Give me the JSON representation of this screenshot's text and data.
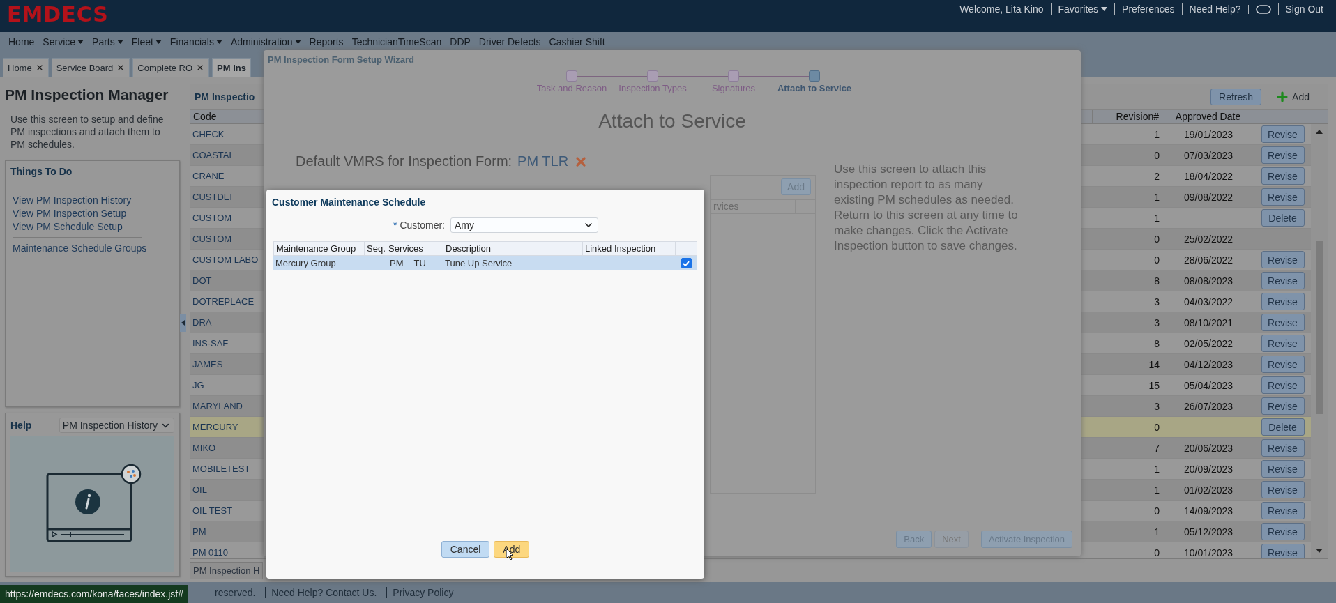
{
  "header": {
    "logo": "EMDECS",
    "links": [
      {
        "kind": "text",
        "label": "Welcome, Lita Kino"
      },
      {
        "kind": "menu",
        "label": "Favorites"
      },
      {
        "kind": "link",
        "label": "Preferences"
      },
      {
        "kind": "link",
        "label": "Need Help?"
      },
      {
        "kind": "icon"
      },
      {
        "kind": "link",
        "label": "Sign Out"
      }
    ]
  },
  "nav": [
    {
      "label": "Home",
      "menu": false
    },
    {
      "label": "Service",
      "menu": true
    },
    {
      "label": "Parts",
      "menu": true
    },
    {
      "label": "Fleet",
      "menu": true
    },
    {
      "label": "Financials",
      "menu": true
    },
    {
      "label": "Administration",
      "menu": true
    },
    {
      "label": "Reports",
      "menu": false
    },
    {
      "label": "TechnicianTimeScan",
      "menu": false
    },
    {
      "label": "DDP",
      "menu": false
    },
    {
      "label": "Driver Defects",
      "menu": false
    },
    {
      "label": "Cashier Shift",
      "menu": false
    }
  ],
  "tabs": [
    {
      "label": "Home",
      "selected": false,
      "closable": true
    },
    {
      "label": "Service Board",
      "selected": false,
      "closable": true
    },
    {
      "label": "Complete RO",
      "selected": false,
      "closable": true
    },
    {
      "label": "PM Ins",
      "selected": true,
      "closable": false
    }
  ],
  "sidebar": {
    "title": "PM Inspection Manager",
    "description": "Use this screen to setup and define PM inspections and attach them to PM schedules.",
    "things_to_do": {
      "title": "Things To Do",
      "links": [
        "View PM Inspection History",
        "View PM Inspection Setup",
        "View PM Schedule Setup"
      ],
      "extra_links": [
        "Maintenance Schedule Groups"
      ]
    },
    "help": {
      "title": "Help",
      "topic": "PM Inspection History"
    }
  },
  "table": {
    "title": "PM Inspectio",
    "buttons": [
      {
        "kind": "plain",
        "label": "Refresh"
      },
      {
        "kind": "add",
        "label": "Add"
      }
    ],
    "columns": [
      "Code",
      "Revision#",
      "Approved Date"
    ],
    "rows": [
      {
        "code": "CHECK",
        "revision": "1",
        "approved_date": "19/01/2023",
        "action": "Revise",
        "selected": false
      },
      {
        "code": "COASTAL",
        "revision": "0",
        "approved_date": "07/03/2023",
        "action": "Revise",
        "selected": false
      },
      {
        "code": "CRANE",
        "revision": "2",
        "approved_date": "18/04/2022",
        "action": "Revise",
        "selected": false
      },
      {
        "code": "CUSTDEF",
        "revision": "1",
        "approved_date": "09/08/2022",
        "action": "Revise",
        "selected": false
      },
      {
        "code": "CUSTOM",
        "revision": "1",
        "action": "Delete",
        "selected": false
      },
      {
        "code": "CUSTOM",
        "revision": "0",
        "approved_date": "25/02/2022",
        "selected": false
      },
      {
        "code": "CUSTOM LABO",
        "revision": "0",
        "approved_date": "28/06/2022",
        "action": "Revise",
        "selected": false
      },
      {
        "code": "DOT",
        "revision": "8",
        "approved_date": "08/08/2023",
        "action": "Revise",
        "selected": false
      },
      {
        "code": "DOTREPLACE",
        "revision": "3",
        "approved_date": "04/03/2022",
        "action": "Revise",
        "selected": false
      },
      {
        "code": "DRA",
        "revision": "3",
        "approved_date": "08/10/2021",
        "action": "Revise",
        "selected": false
      },
      {
        "code": "INS-SAF",
        "revision": "8",
        "approved_date": "02/05/2022",
        "action": "Revise",
        "selected": false
      },
      {
        "code": "JAMES",
        "revision": "14",
        "approved_date": "04/12/2023",
        "action": "Revise",
        "selected": false
      },
      {
        "code": "JG",
        "revision": "15",
        "approved_date": "05/04/2023",
        "action": "Revise",
        "selected": false
      },
      {
        "code": "MARYLAND",
        "revision": "3",
        "approved_date": "26/07/2023",
        "action": "Revise",
        "selected": false
      },
      {
        "code": "MERCURY",
        "revision": "0",
        "action": "Delete",
        "selected": true
      },
      {
        "code": "MIKO",
        "revision": "7",
        "approved_date": "20/06/2023",
        "action": "Revise",
        "selected": false
      },
      {
        "code": "MOBILETEST",
        "revision": "1",
        "approved_date": "20/09/2023",
        "action": "Revise",
        "selected": false
      },
      {
        "code": "OIL",
        "revision": "1",
        "approved_date": "01/02/2023",
        "action": "Revise",
        "selected": false
      },
      {
        "code": "OIL TEST",
        "revision": "0",
        "approved_date": "14/09/2023",
        "action": "Revise",
        "selected": false
      },
      {
        "code": "PM",
        "revision": "1",
        "approved_date": "05/12/2023",
        "action": "Revise",
        "selected": false
      },
      {
        "code": "PM 0110",
        "revision": "0",
        "approved_date": "10/01/2023",
        "action": "Revise",
        "selected": false
      }
    ],
    "bottom_tab": "PM Inspection H"
  },
  "wizard": {
    "title": "PM Inspection Form Setup Wizard",
    "steps": [
      {
        "label": "Task and Reason",
        "selected": false
      },
      {
        "label": "Inspection Types",
        "selected": false
      },
      {
        "label": "Signatures",
        "selected": false
      },
      {
        "label": "Attach to Service",
        "selected": true
      }
    ],
    "heading": "Attach to Service",
    "vmrs_label": "Default VMRS for Inspection Form:",
    "vmrs_value": "PM TLR",
    "services_panel": {
      "button": "Add",
      "column": "rvices"
    },
    "help_text": "Use this screen to attach this inspection report to as many existing PM schedules as needed. Return to this screen at any time to make changes. Click the Activate Inspection button to save changes.",
    "buttons": [
      {
        "label": "Back",
        "disabled": false
      },
      {
        "label": "Next",
        "disabled": true
      },
      {
        "label": "Activate Inspection",
        "disabled": false
      }
    ]
  },
  "dialog": {
    "title": "Customer Maintenance Schedule",
    "required_mark": "*",
    "customer_label": "Customer:",
    "customer": "Amy",
    "table": {
      "columns": [
        "Maintenance Group",
        "Seq.",
        "Services",
        "Description",
        "Linked Inspection"
      ],
      "rows": [
        {
          "group": "Mercury Group",
          "services": [
            "PM",
            "TU"
          ],
          "description": "Tune Up Service",
          "selected": true,
          "checked": true
        }
      ]
    },
    "buttons": [
      {
        "kind": "cancel",
        "label": "Cancel"
      },
      {
        "kind": "primary",
        "label": "Add"
      }
    ]
  },
  "footer": {
    "texts": [
      "reserved.",
      "Need Help? Contact Us.",
      "Privacy Policy"
    ]
  },
  "status_url": "https://emdecs.com/kona/faces/index.jsf#"
}
